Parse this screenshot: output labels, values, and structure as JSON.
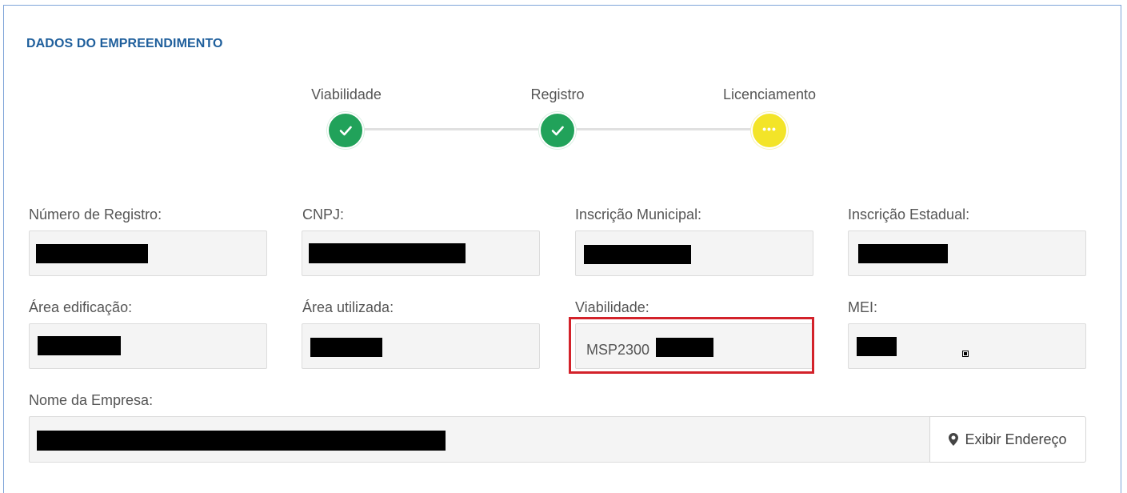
{
  "section": {
    "title": "DADOS DO EMPREENDIMENTO"
  },
  "steps": [
    {
      "label": "Viabilidade",
      "status": "done"
    },
    {
      "label": "Registro",
      "status": "done"
    },
    {
      "label": "Licenciamento",
      "status": "pending",
      "icon": "more-dots-icon"
    }
  ],
  "fields": {
    "numero_registro": {
      "label": "Número de Registro:",
      "value": ""
    },
    "cnpj": {
      "label": "CNPJ:",
      "value": ""
    },
    "inscricao_municipal": {
      "label": "Inscrição Municipal:",
      "value": ""
    },
    "inscricao_estadual": {
      "label": "Inscrição Estadual:",
      "value": ""
    },
    "area_edificacao": {
      "label": "Área edificação:",
      "value": ""
    },
    "area_utilizada": {
      "label": "Área utilizada:",
      "value": ""
    },
    "viabilidade": {
      "label": "Viabilidade:",
      "value": "MSP2300"
    },
    "mei": {
      "label": "MEI:",
      "value": ""
    },
    "nome_empresa": {
      "label": "Nome da Empresa:",
      "value": ""
    }
  },
  "actions": {
    "exibir_endereco": "Exibir Endereço",
    "exibir_endereco_icon": "map-marker-icon"
  },
  "colors": {
    "done": "#21a25a",
    "pending": "#f3e428",
    "title": "#1f5f9c",
    "highlight": "#d3222a"
  }
}
